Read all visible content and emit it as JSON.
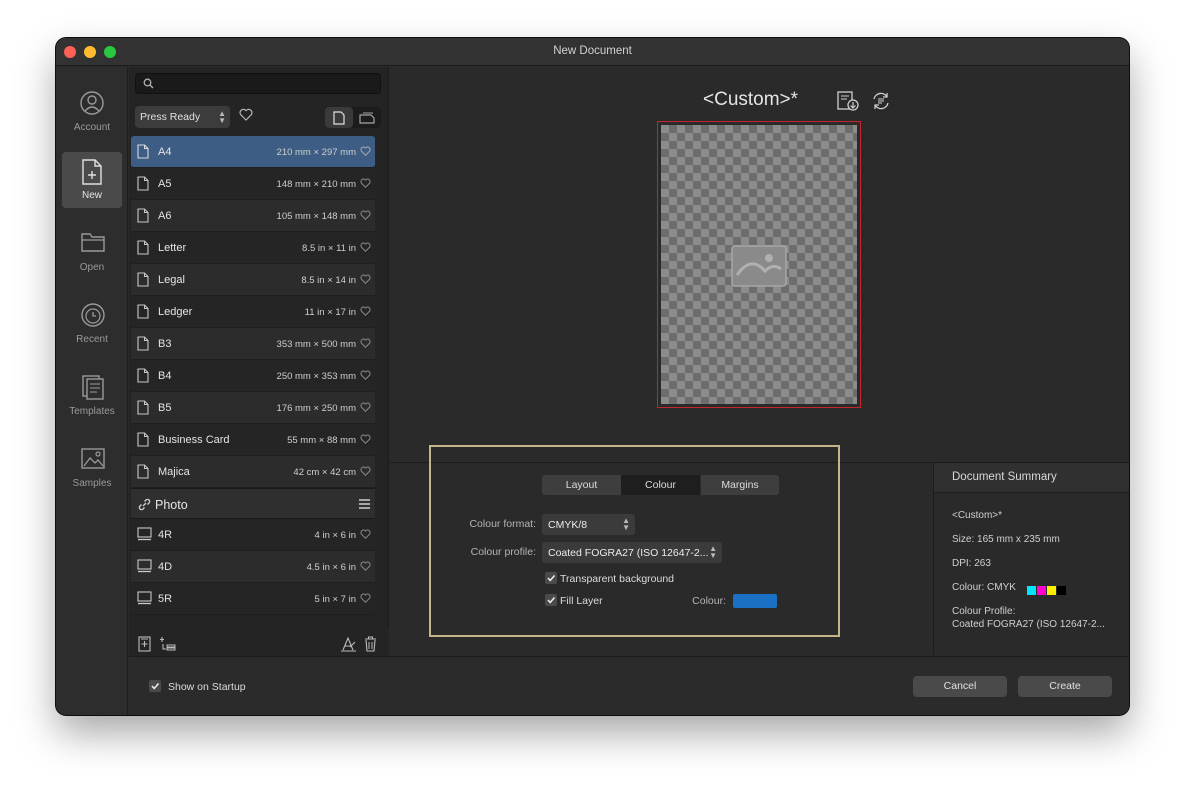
{
  "window": {
    "title": "New Document"
  },
  "sidebar": {
    "items": [
      {
        "label": "Account",
        "icon": "account-icon"
      },
      {
        "label": "New",
        "icon": "new-document-icon",
        "active": true
      },
      {
        "label": "Open",
        "icon": "folder-icon"
      },
      {
        "label": "Recent",
        "icon": "recent-clock-icon"
      },
      {
        "label": "Templates",
        "icon": "templates-icon"
      },
      {
        "label": "Samples",
        "icon": "samples-image-icon"
      }
    ]
  },
  "presets": {
    "search_placeholder": "",
    "category": "Press Ready",
    "items": [
      {
        "name": "A4",
        "size": "210 mm × 297 mm"
      },
      {
        "name": "A5",
        "size": "148 mm × 210 mm"
      },
      {
        "name": "A6",
        "size": "105 mm × 148 mm"
      },
      {
        "name": "Letter",
        "size": "8.5 in × 11 in"
      },
      {
        "name": "Legal",
        "size": "8.5 in × 14 in"
      },
      {
        "name": "Ledger",
        "size": "11 in × 17 in"
      },
      {
        "name": "B3",
        "size": "353 mm × 500 mm"
      },
      {
        "name": "B4",
        "size": "250 mm × 353 mm"
      },
      {
        "name": "B5",
        "size": "176 mm × 250 mm"
      },
      {
        "name": "Business Card",
        "size": "55 mm × 88 mm"
      },
      {
        "name": "Majica",
        "size": "42 cm × 42 cm"
      }
    ],
    "section": "Photo",
    "photo_items": [
      {
        "name": "4R",
        "size": "4 in × 6 in"
      },
      {
        "name": "4D",
        "size": "4.5 in × 6 in"
      },
      {
        "name": "5R",
        "size": "5 in × 7 in"
      }
    ]
  },
  "preview": {
    "title": "<Custom>*"
  },
  "settings": {
    "tabs": [
      "Layout",
      "Colour",
      "Margins"
    ],
    "active_tab": "Colour",
    "colour_format_label": "Colour format:",
    "colour_format": "CMYK/8",
    "colour_profile_label": "Colour profile:",
    "colour_profile": "Coated FOGRA27 (ISO 12647-2...",
    "transparent_background": "Transparent background",
    "fill_layer": "Fill Layer",
    "colour_label": "Colour:",
    "fill_colour": "#1a71c4"
  },
  "summary": {
    "heading": "Document Summary",
    "name": "<Custom>*",
    "size": "Size: 165 mm x 235 mm",
    "dpi": "DPI:  263",
    "colour": "Colour: CMYK",
    "profile_label": "Colour Profile:",
    "profile_value": "Coated FOGRA27 (ISO 12647-2..."
  },
  "footer": {
    "show_on_startup": "Show on Startup",
    "cancel": "Cancel",
    "create": "Create"
  },
  "colors": {
    "selection": "#3d5d84",
    "canvas_border": "#c3272b",
    "highlight_box": "#c5b68a"
  }
}
